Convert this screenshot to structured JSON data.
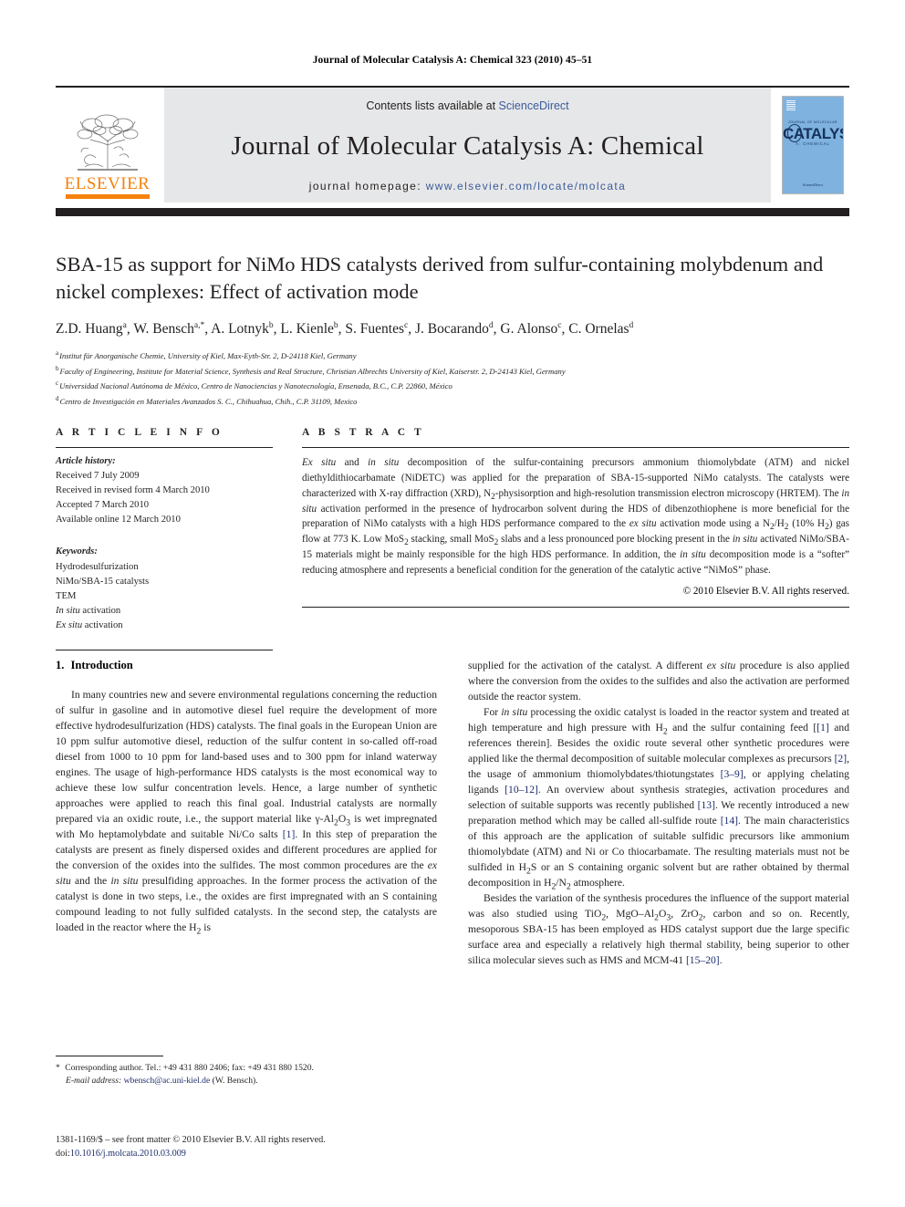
{
  "running_head": "Journal of Molecular Catalysis A: Chemical 323 (2010) 45–51",
  "masthead": {
    "contents_prefix": "Contents lists available at ",
    "contents_link": "ScienceDirect",
    "journal_title": "Journal of Molecular Catalysis A: Chemical",
    "homepage_prefix": "journal homepage: ",
    "homepage_url": "www.elsevier.com/locate/molcata",
    "publisher_logo_text": "ELSEVIER",
    "publisher_logo_color": "#f5820b",
    "link_color": "#3b5b9b",
    "cover": {
      "top_label": "JOURNAL OF MOLECULAR",
      "main_label": "CATALYSIS",
      "sub_label": "A: CHEMICAL",
      "footer_label": "ScienceDirect",
      "background_color": "#7fb2df"
    }
  },
  "article": {
    "title": "SBA-15 as support for NiMo HDS catalysts derived from sulfur-containing molybdenum and nickel complexes: Effect of activation mode",
    "authors_html": "Z.D. Huang<sup>a</sup>, W. Bensch<sup>a,*</sup>, A. Lotnyk<sup>b</sup>, L. Kienle<sup>b</sup>, S. Fuentes<sup>c</sup>, J. Bocarando<sup>d</sup>, G. Alonso<sup>c</sup>, C. Ornelas<sup>d</sup>",
    "affiliations": [
      {
        "mark": "a",
        "text": "Institut für Anorganische Chemie, University of Kiel, Max-Eyth-Str. 2, D-24118 Kiel, Germany"
      },
      {
        "mark": "b",
        "text": "Faculty of Engineering, Institute for Material Science, Synthesis and Real Structure, Christian Albrechts University of Kiel, Kaiserstr. 2, D-24143 Kiel, Germany"
      },
      {
        "mark": "c",
        "text": "Universidad Nacional Autónoma de México, Centro de Nanociencias y Nanotecnología, Ensenada, B.C., C.P. 22860, México"
      },
      {
        "mark": "d",
        "text": "Centro de Investigación en Materiales Avanzados S. C., Chihuahua, Chih., C.P. 31109, Mexico"
      }
    ]
  },
  "article_info": {
    "heading": "A R T I C L E  I N F O",
    "history_label": "Article history:",
    "history": [
      "Received 7 July 2009",
      "Received in revised form 4 March 2010",
      "Accepted 7 March 2010",
      "Available online 12 March 2010"
    ],
    "keywords_label": "Keywords:",
    "keywords_html": [
      "Hydrodesulfurization",
      "NiMo/SBA-15 catalysts",
      "TEM",
      "<span class=\"it\">In situ</span> activation",
      "<span class=\"it\">Ex situ</span> activation"
    ]
  },
  "abstract": {
    "heading": "A B S T R A C T",
    "text_html": "<span class=\"it\">Ex situ</span> and <span class=\"it\">in situ</span> decomposition of the sulfur-containing precursors ammonium thiomolybdate (ATM) and nickel diethyldithiocarbamate (NiDETC) was applied for the preparation of SBA-15-supported NiMo catalysts. The catalysts were characterized with X-ray diffraction (XRD), N<sub>2</sub>-physisorption and high-resolution transmission electron microscopy (HRTEM). The <span class=\"it\">in situ</span> activation performed in the presence of hydrocarbon solvent during the HDS of dibenzothiophene is more beneficial for the preparation of NiMo catalysts with a high HDS performance compared to the <span class=\"it\">ex situ</span> activation mode using a N<sub>2</sub>/H<sub>2</sub> (10% H<sub>2</sub>) gas flow at 773 K. Low MoS<sub>2</sub> stacking, small MoS<sub>2</sub> slabs and a less pronounced pore blocking present in the <span class=\"it\">in situ</span> activated NiMo/SBA-15 materials might be mainly responsible for the high HDS performance. In addition, the <span class=\"it\">in situ</span> decomposition mode is a “softer” reducing atmosphere and represents a beneficial condition for the generation of the catalytic active “NiMoS” phase.",
    "copyright": "© 2010 Elsevier B.V. All rights reserved."
  },
  "sections": {
    "introduction": {
      "number": "1.",
      "title": "Introduction",
      "left_paragraphs_html": [
        "In many countries new and severe environmental regulations concerning the reduction of sulfur in gasoline and in automotive diesel fuel require the development of more effective hydrodesulfurization (HDS) catalysts. The final goals in the European Union are 10 ppm sulfur automotive diesel, reduction of the sulfur content in so-called off-road diesel from 1000 to 10 ppm for land-based uses and to 300 ppm for inland waterway engines. The usage of high-performance HDS catalysts is the most economical way to achieve these low sulfur concentration levels. Hence, a large number of synthetic approaches were applied to reach this final goal. Industrial catalysts are normally prepared via an oxidic route, i.e., the support material like γ-Al<sub>2</sub>O<sub>3</sub> is wet impregnated with Mo heptamolybdate and suitable Ni/Co salts <span class=\"ref\">[1]</span>. In this step of preparation the catalysts are present as finely dispersed oxides and different procedures are applied for the conversion of the oxides into the sulfides. The most common procedures are the <span class=\"it\">ex situ</span> and the <span class=\"it\">in situ</span> presulfiding approaches. In the former process the activation of the catalyst is done in two steps, i.e., the oxides are first impregnated with an S containing compound leading to not fully sulfided catalysts. In the second step, the catalysts are loaded in the reactor where the H<sub>2</sub> is"
      ],
      "right_paragraphs_html": [
        "supplied for the activation of the catalyst. A different <span class=\"it\">ex situ</span> procedure is also applied where the conversion from the oxides to the sulfides and also the activation are performed outside the reactor system.",
        "For <span class=\"it\">in situ</span> processing the oxidic catalyst is loaded in the reactor system and treated at high temperature and high pressure with H<sub>2</sub> and the sulfur containing feed [<span class=\"ref\">[1]</span> and references therein]. Besides the oxidic route several other synthetic procedures were applied like the thermal decomposition of suitable molecular complexes as precursors <span class=\"ref\">[2]</span>, the usage of ammonium thiomolybdates/thiotungstates <span class=\"ref\">[3–9]</span>, or applying chelating ligands <span class=\"ref\">[10–12]</span>. An overview about synthesis strategies, activation procedures and selection of suitable supports was recently published <span class=\"ref\">[13]</span>. We recently introduced a new preparation method which may be called all-sulfide route <span class=\"ref\">[14]</span>. The main characteristics of this approach are the application of suitable sulfidic precursors like ammonium thiomolybdate (ATM) and Ni or Co thiocarbamate. The resulting materials must not be sulfided in H<sub>2</sub>S or an S containing organic solvent but are rather obtained by thermal decomposition in H<sub>2</sub>/N<sub>2</sub> atmosphere.",
        "Besides the variation of the synthesis procedures the influence of the support material was also studied using TiO<sub>2</sub>, MgO–Al<sub>2</sub>O<sub>3</sub>, ZrO<sub>2</sub>, carbon and so on. Recently, mesoporous SBA-15 has been employed as HDS catalyst support due the large specific surface area and especially a relatively high thermal stability, being superior to other silica molecular sieves such as HMS and MCM-41 <span class=\"ref\">[15–20]</span>."
      ]
    }
  },
  "footnote": {
    "corresponding_html": "<span class=\"star\">*</span> Corresponding author. Tel.: +49 431 880 2406; fax: +49 431 880 1520.",
    "email_label": "E-mail address:",
    "email": "wbensch@ac.uni-kiel.de",
    "email_suffix": "(W. Bensch)."
  },
  "imprint": {
    "line1": "1381-1169/$ – see front matter © 2010 Elsevier B.V. All rights reserved.",
    "doi_label": "doi:",
    "doi_value": "10.1016/j.molcata.2010.03.009"
  }
}
